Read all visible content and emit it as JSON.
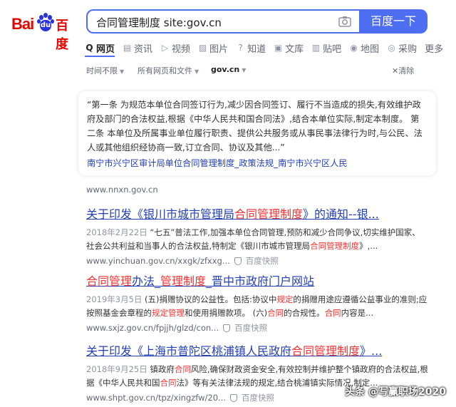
{
  "logo": {
    "bai": "Bai",
    "paw": "du",
    "du": "百度"
  },
  "search": {
    "query": "合同管理制度 site:gov.cn",
    "button": "百度一下"
  },
  "tabs": [
    {
      "label": "网页",
      "icon": "search-icon",
      "glyph": "Q"
    },
    {
      "label": "资讯",
      "icon": "news-icon",
      "glyph": "▤"
    },
    {
      "label": "视频",
      "icon": "video-icon",
      "glyph": "▷"
    },
    {
      "label": "图片",
      "icon": "image-icon",
      "glyph": "▨"
    },
    {
      "label": "知道",
      "icon": "question-icon",
      "glyph": "?"
    },
    {
      "label": "文库",
      "icon": "document-icon",
      "glyph": "▣"
    },
    {
      "label": "贴吧",
      "icon": "tieba-icon",
      "glyph": "▥"
    },
    {
      "label": "地图",
      "icon": "map-pin-icon",
      "glyph": "◉"
    },
    {
      "label": "采购",
      "icon": "shopping-icon",
      "glyph": "◎"
    },
    {
      "label": "更多",
      "icon": "",
      "glyph": ""
    }
  ],
  "filters": {
    "time": "时间不限",
    "type": "所有网页和文件",
    "site": "gov.cn",
    "clear": "清除"
  },
  "card": {
    "text": "“第一条 为规范本单位合同签订行为,减少因合同签订、履行不当造成的损失,有效维护政府及部门的合法权益,根据《中华人民共和国合同法》,结合本单位实际,制定本制度。 第二条 本单位及所属事业单位履行职责、提供公共服务或从事民事法律行为时,与公民、法人或其他组织经协商一致,订立合同、协议及其他...”",
    "link": "南宁市兴宁区审计局单位合同管理制度_政策法规_南宁市兴宁区人民",
    "domain": "www.nnxn.gov.cn"
  },
  "results": [
    {
      "title_pre": "关于印发《银川市城市管理局",
      "title_hl": "合同管理制度",
      "title_post": "》的通知--银...",
      "date": "2018年2月22日",
      "abstract_pre": " “七五”普法工作,加强本单位合同管理,预防和减少合同争议,切实维护国家、社会公共利益和当事人的合法权益,特制定《银川市城市管理局",
      "abstract_hl": "合同管理制度",
      "abstract_post": "》,...",
      "url": "www.yinchuan.gov.cn/xxgk/zfxxg...",
      "cache": "百度快照"
    },
    {
      "title_hl1": "合同管理",
      "title_mid1": "办法_",
      "title_hl2": "管理制度",
      "title_post": "_晋中市政府门户网站",
      "date": "2019年3月5日",
      "a1": " (五)捐赠协议的公益性。包括:协议中",
      "h1": "规定",
      "a2": "的捐赠用途应遵循公益事业的准则;应按照基金会章程的",
      "h2": "规定管理",
      "a3": "和使用捐赠款项。 (六)",
      "h3": "合同",
      "a4": "的合规性。",
      "h4": "合同",
      "a5": "内容是...",
      "url": "www.sxjz.gov.cn/fpjjh/glzd/con...",
      "cache": "百度快照"
    },
    {
      "title_pre": "关于印发《上海市普陀区桃浦镇人民政府",
      "title_hl": "合同管理制度",
      "title_post": "》...",
      "date": "2018年9月25日",
      "a1": " 镇政府",
      "h1": "合同",
      "a2": "风险,确保财政资金安全,有效控制并维护整个镇政府的合法权益,根据《中华人民共和国",
      "h2": "合同",
      "a3": "法》等有关法律法规的规定,结合桃浦镇实际情况,制定...",
      "url": "www.shpt.gov.cn/tpz/xingzfw/20...",
      "cache": "百度快照"
    }
  ],
  "watermark": "头条 @写赢职场2020",
  "colors": {
    "accent": "#4e6ef2",
    "link": "#2440b3",
    "highlight": "#f73131",
    "brand_red": "#e10601",
    "brand_blue": "#2932e1"
  }
}
